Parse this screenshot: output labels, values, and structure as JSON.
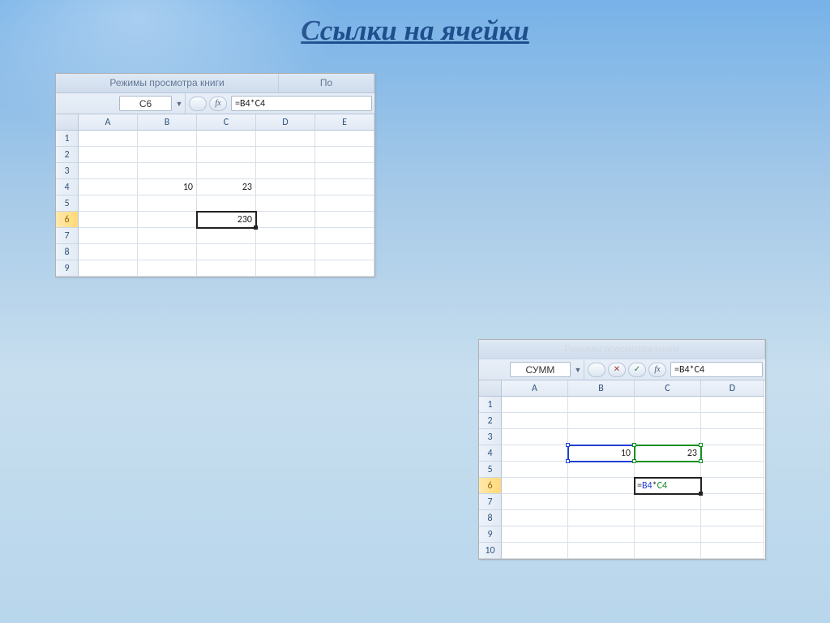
{
  "title": "Ссылки на ячейки",
  "shot1": {
    "ribbon_group_main": "Режимы просмотра книги",
    "ribbon_group_side": "По",
    "namebox": "C6",
    "formula": "=B4*C4",
    "columns": [
      "A",
      "B",
      "C",
      "D",
      "E"
    ],
    "rows": [
      "1",
      "2",
      "3",
      "4",
      "5",
      "6",
      "7",
      "8",
      "9"
    ],
    "cells": {
      "B4": "10",
      "C4": "23",
      "C6": "230"
    },
    "active_row": "6",
    "selected_cell": "C6"
  },
  "shot2": {
    "ribbon_group_main": "Режимы просмотра книги",
    "namebox": "СУММ",
    "formula": "=B4*C4",
    "columns": [
      "A",
      "B",
      "C",
      "D"
    ],
    "rows": [
      "1",
      "2",
      "3",
      "4",
      "5",
      "6",
      "7",
      "8",
      "9",
      "10"
    ],
    "cells": {
      "B4": "10",
      "C4": "23"
    },
    "edit_cell": "C6",
    "edit_cell_text_eq": "=",
    "edit_cell_text_b": "B4",
    "edit_cell_text_op": "*",
    "edit_cell_text_c": "C4",
    "active_row": "6",
    "ref_blue": "B4",
    "ref_green": "C4"
  }
}
